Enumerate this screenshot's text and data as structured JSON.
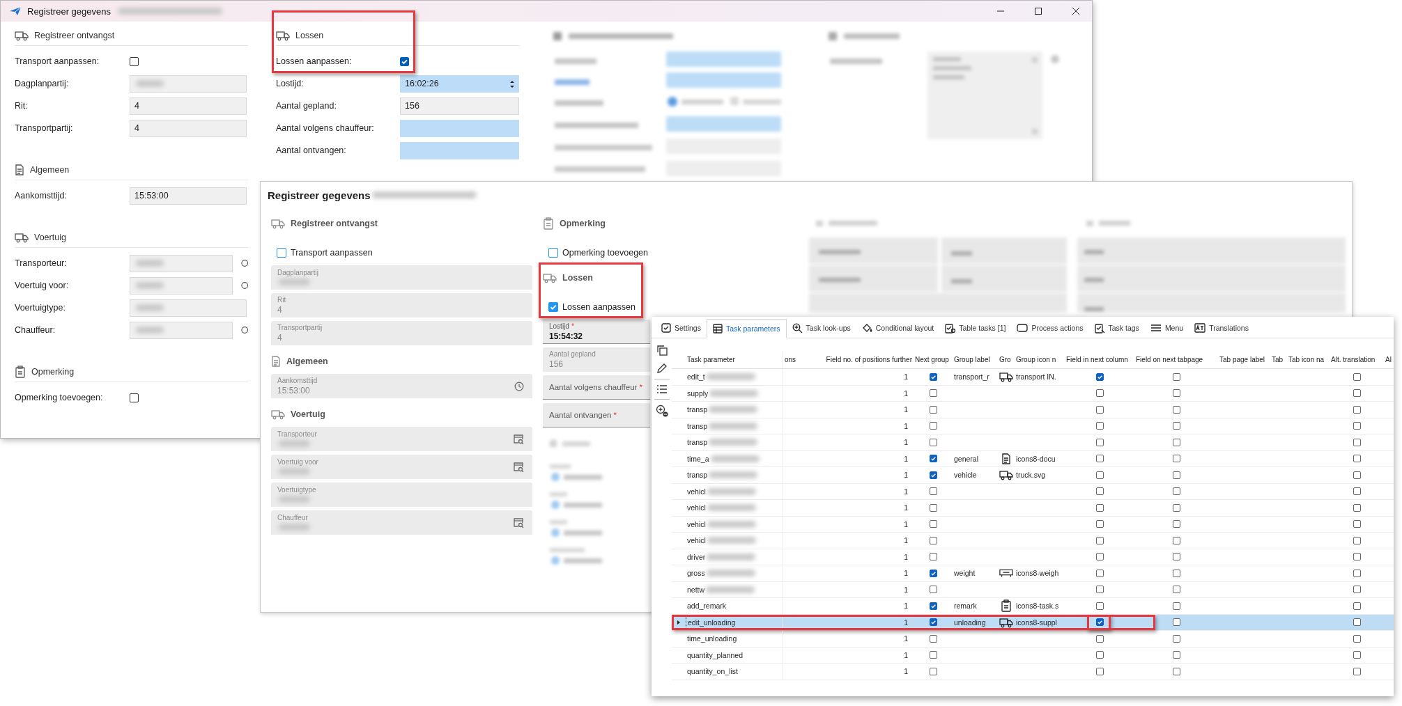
{
  "desktop_window": {
    "title": "Registreer gegevens",
    "title_redacted": true,
    "columns": [
      {
        "sections": [
          {
            "title": "Registreer ontvangst",
            "highlighted": false,
            "fields": [
              {
                "kind": "checkbox",
                "label": "Transport aanpassen:",
                "checked": false
              },
              {
                "kind": "text",
                "label": "Dagplanpartij:",
                "redacted": true,
                "required": false
              },
              {
                "kind": "text",
                "label": "Rit:",
                "value": "4",
                "redacted": false,
                "required": false
              },
              {
                "kind": "text",
                "label": "Transportpartij:",
                "value": "4",
                "redacted": false,
                "required": false
              }
            ]
          },
          {
            "title": "Algemeen",
            "highlighted": false,
            "fields": [
              {
                "kind": "text",
                "label": "Aankomsttijd:",
                "value": "15:53:00",
                "redacted": false,
                "required": false
              }
            ]
          },
          {
            "title": "Voertuig",
            "highlighted": false,
            "fields": [
              {
                "kind": "lookup",
                "label": "Transporteur:",
                "redacted": true,
                "required": false
              },
              {
                "kind": "lookup",
                "label": "Voertuig voor:",
                "redacted": true,
                "required": false
              },
              {
                "kind": "text",
                "label": "Voertuigtype:",
                "redacted": true,
                "required": false
              },
              {
                "kind": "lookup",
                "label": "Chauffeur:",
                "redacted": true,
                "required": false
              }
            ]
          },
          {
            "title": "Opmerking",
            "highlighted": false,
            "fields": [
              {
                "kind": "checkbox",
                "label": "Opmerking toevoegen:",
                "checked": false
              }
            ]
          }
        ]
      },
      {
        "sections": [
          {
            "title": "Lossen",
            "highlighted": true,
            "fields": [
              {
                "kind": "checkbox",
                "label": "Lossen aanpassen:",
                "checked": true
              },
              {
                "kind": "spin",
                "label": "Lostijd:",
                "value": "16:02:26",
                "redacted": false,
                "required": true
              },
              {
                "kind": "text",
                "label": "Aantal gepland:",
                "value": "156",
                "redacted": false,
                "required": false
              },
              {
                "kind": "text",
                "label": "Aantal volgens chauffeur:",
                "redacted": false,
                "required": true
              },
              {
                "kind": "text",
                "label": "Aantal ontvangen:",
                "redacted": false,
                "required": true
              }
            ]
          }
        ]
      }
    ]
  },
  "web_window": {
    "title": "Registreer gegevens",
    "title_redacted": true,
    "columns": [
      {
        "sections": [
          {
            "title": "Registreer ontvangst",
            "highlighted": false,
            "fields": [
              {
                "kind": "checkbox",
                "label": "Transport aanpassen",
                "checked": false
              },
              {
                "kind": "text",
                "label": "Dagplanpartij",
                "redacted": true,
                "disabled": true
              },
              {
                "kind": "text",
                "label": "Rit",
                "value": "4",
                "redacted": false,
                "disabled": true
              },
              {
                "kind": "text",
                "label": "Transportpartij",
                "value": "4",
                "redacted": false,
                "disabled": true
              }
            ]
          },
          {
            "title": "Algemeen",
            "highlighted": false,
            "fields": [
              {
                "kind": "time",
                "label": "Aankomsttijd",
                "value": "15:53:00",
                "redacted": false,
                "disabled": true
              }
            ]
          },
          {
            "title": "Voertuig",
            "highlighted": false,
            "fields": [
              {
                "kind": "lookup",
                "label": "Transporteur",
                "redacted": true,
                "disabled": true
              },
              {
                "kind": "lookup",
                "label": "Voertuig voor",
                "redacted": true,
                "disabled": true
              },
              {
                "kind": "text",
                "label": "Voertuigtype",
                "redacted": true,
                "disabled": true
              },
              {
                "kind": "lookup",
                "label": "Chauffeur",
                "redacted": true,
                "disabled": true
              }
            ]
          }
        ]
      },
      {
        "sections": [
          {
            "title": "Opmerking",
            "highlighted": false,
            "fields": [
              {
                "kind": "checkbox",
                "label": "Opmerking toevoegen",
                "checked": false
              }
            ]
          },
          {
            "title": "Lossen",
            "highlighted": true,
            "fields": [
              {
                "kind": "checkbox",
                "label": "Lossen aanpassen",
                "checked": true
              },
              {
                "kind": "text",
                "label": "Lostijd",
                "required_mark": "*",
                "value": "15:54:32",
                "redacted": false,
                "disabled": false
              },
              {
                "kind": "text",
                "label": "Aantal gepland",
                "value": "156",
                "redacted": false,
                "disabled": true
              },
              {
                "kind": "text",
                "label": "Aantal volgens chauffeur",
                "required_mark": "*",
                "redacted": false,
                "disabled": false
              },
              {
                "kind": "text",
                "label": "Aantal ontvangen",
                "required_mark": "*",
                "redacted": false,
                "disabled": false
              }
            ]
          }
        ]
      }
    ]
  },
  "task_window": {
    "tabs": [
      {
        "label": "Settings",
        "selected": false
      },
      {
        "label": "Task parameters",
        "selected": true
      },
      {
        "label": "Task look-ups",
        "selected": false
      },
      {
        "label": "Conditional layout",
        "selected": false
      },
      {
        "label": "Table tasks [1]",
        "selected": false
      },
      {
        "label": "Process actions",
        "selected": false
      },
      {
        "label": "Task tags",
        "selected": false
      },
      {
        "label": "Menu",
        "selected": false
      },
      {
        "label": "Translations",
        "selected": false
      }
    ],
    "columns": [
      "Task parameter",
      "ons",
      "Field no. of positions further",
      "Next group",
      "Group label",
      "Gro",
      "Group icon n",
      "Field in next column",
      "Field on next tabpage",
      "Tab page label",
      "Tab",
      "Tab icon na",
      "Alt. translation",
      "Al"
    ],
    "rows": [
      {
        "task_parameter": "edit_t",
        "redacted": true,
        "positions": "1",
        "next_group": true,
        "group_label": "transport_r",
        "group_icon_name": "transport IN.",
        "field_in_next_column": true,
        "field_on_next_tabpage": false,
        "alt_translation": false,
        "selected": false,
        "highlighted": false,
        "next_column_highlighted": false
      },
      {
        "task_parameter": "supply",
        "redacted": true,
        "positions": "1",
        "next_group": false,
        "field_in_next_column": false,
        "field_on_next_tabpage": false,
        "alt_translation": false,
        "selected": false,
        "highlighted": false,
        "next_column_highlighted": false
      },
      {
        "task_parameter": "transp",
        "redacted": true,
        "positions": "1",
        "next_group": false,
        "field_in_next_column": false,
        "field_on_next_tabpage": false,
        "alt_translation": false,
        "selected": false,
        "highlighted": false,
        "next_column_highlighted": false
      },
      {
        "task_parameter": "transp",
        "redacted": true,
        "positions": "1",
        "next_group": false,
        "field_in_next_column": false,
        "field_on_next_tabpage": false,
        "alt_translation": false,
        "selected": false,
        "highlighted": false,
        "next_column_highlighted": false
      },
      {
        "task_parameter": "transp",
        "redacted": true,
        "positions": "1",
        "next_group": false,
        "field_in_next_column": false,
        "field_on_next_tabpage": false,
        "alt_translation": false,
        "selected": false,
        "highlighted": false,
        "next_column_highlighted": false
      },
      {
        "task_parameter": "time_a",
        "redacted": true,
        "positions": "1",
        "next_group": true,
        "group_label": "general",
        "group_icon_name": "icons8-docu",
        "field_in_next_column": false,
        "field_on_next_tabpage": false,
        "alt_translation": false,
        "selected": false,
        "highlighted": false,
        "next_column_highlighted": false
      },
      {
        "task_parameter": "transp",
        "redacted": true,
        "positions": "1",
        "next_group": true,
        "group_label": "vehicle",
        "group_icon_name": "truck.svg",
        "field_in_next_column": false,
        "field_on_next_tabpage": false,
        "alt_translation": false,
        "selected": false,
        "highlighted": false,
        "next_column_highlighted": false
      },
      {
        "task_parameter": "vehicl",
        "redacted": true,
        "positions": "1",
        "next_group": false,
        "field_in_next_column": false,
        "field_on_next_tabpage": false,
        "alt_translation": false,
        "selected": false,
        "highlighted": false,
        "next_column_highlighted": false
      },
      {
        "task_parameter": "vehicl",
        "redacted": true,
        "positions": "1",
        "next_group": false,
        "field_in_next_column": false,
        "field_on_next_tabpage": false,
        "alt_translation": false,
        "selected": false,
        "highlighted": false,
        "next_column_highlighted": false
      },
      {
        "task_parameter": "vehicl",
        "redacted": true,
        "positions": "1",
        "next_group": false,
        "field_in_next_column": false,
        "field_on_next_tabpage": false,
        "alt_translation": false,
        "selected": false,
        "highlighted": false,
        "next_column_highlighted": false
      },
      {
        "task_parameter": "vehicl",
        "redacted": true,
        "positions": "1",
        "next_group": false,
        "field_in_next_column": false,
        "field_on_next_tabpage": false,
        "alt_translation": false,
        "selected": false,
        "highlighted": false,
        "next_column_highlighted": false
      },
      {
        "task_parameter": "driver",
        "redacted": true,
        "positions": "1",
        "next_group": false,
        "field_in_next_column": false,
        "field_on_next_tabpage": false,
        "alt_translation": false,
        "selected": false,
        "highlighted": false,
        "next_column_highlighted": false
      },
      {
        "task_parameter": "gross",
        "redacted": true,
        "positions": "1",
        "next_group": true,
        "group_label": "weight",
        "group_icon_name": "icons8-weigh",
        "field_in_next_column": false,
        "field_on_next_tabpage": false,
        "alt_translation": false,
        "selected": false,
        "highlighted": false,
        "next_column_highlighted": false
      },
      {
        "task_parameter": "nettw",
        "redacted": true,
        "positions": "1",
        "next_group": false,
        "field_in_next_column": false,
        "field_on_next_tabpage": false,
        "alt_translation": false,
        "selected": false,
        "highlighted": false,
        "next_column_highlighted": false
      },
      {
        "task_parameter": "add_remark",
        "redacted": false,
        "positions": "1",
        "next_group": true,
        "group_label": "remark",
        "group_icon_name": "icons8-task.s",
        "field_in_next_column": false,
        "field_on_next_tabpage": false,
        "alt_translation": false,
        "selected": false,
        "highlighted": false,
        "next_column_highlighted": false
      },
      {
        "task_parameter": "edit_unloading",
        "redacted": false,
        "positions": "1",
        "next_group": true,
        "group_label": "unloading",
        "group_icon_name": "icons8-suppl",
        "field_in_next_column": true,
        "field_on_next_tabpage": false,
        "alt_translation": false,
        "selected": true,
        "highlighted": true,
        "next_column_highlighted": true
      },
      {
        "task_parameter": "time_unloading",
        "redacted": false,
        "positions": "1",
        "next_group": false,
        "field_in_next_column": false,
        "field_on_next_tabpage": false,
        "alt_translation": false,
        "selected": false,
        "highlighted": false,
        "next_column_highlighted": false
      },
      {
        "task_parameter": "quantity_planned",
        "redacted": false,
        "positions": "1",
        "next_group": false,
        "field_in_next_column": false,
        "field_on_next_tabpage": false,
        "alt_translation": false,
        "selected": false,
        "highlighted": false,
        "next_column_highlighted": false
      },
      {
        "task_parameter": "quantity_on_list",
        "redacted": false,
        "positions": "1",
        "next_group": false,
        "field_in_next_column": false,
        "field_on_next_tabpage": false,
        "alt_translation": false,
        "selected": false,
        "highlighted": false,
        "next_column_highlighted": false
      }
    ]
  }
}
